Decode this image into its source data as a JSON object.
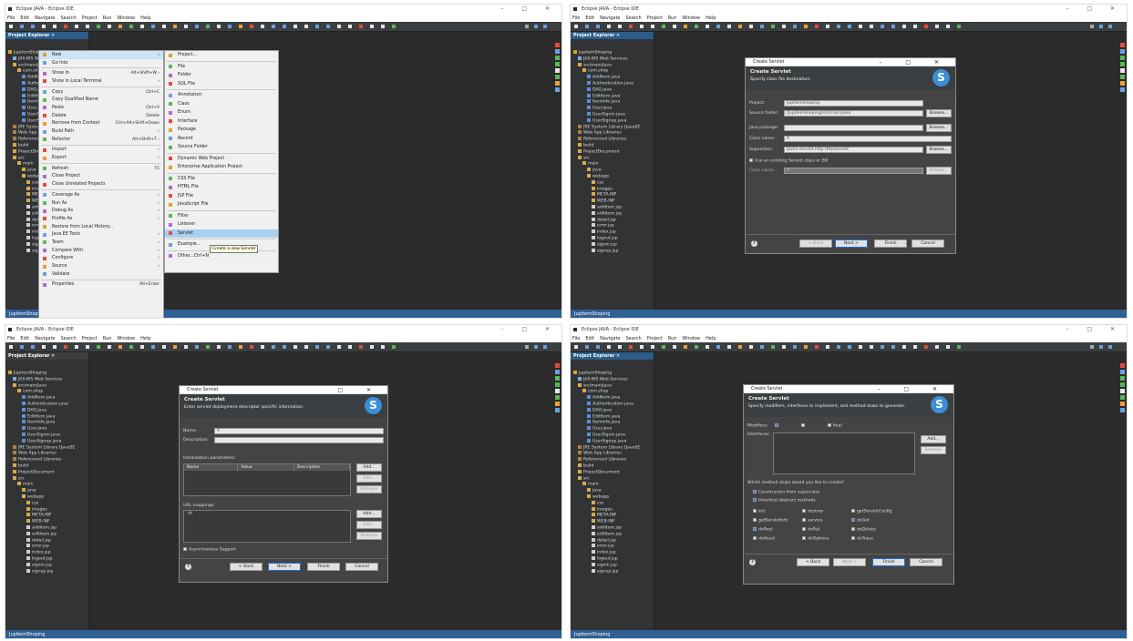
{
  "window": {
    "title": "Eclipse JAVA - Eclipse IDE",
    "menu": [
      "File",
      "Edit",
      "Navigate",
      "Search",
      "Project",
      "Run",
      "Window",
      "Help"
    ],
    "controls": [
      "–",
      "□",
      "✕"
    ]
  },
  "project_explorer": {
    "tab_label": "Project Explorer",
    "tree": [
      {
        "label": "JupitemShoping",
        "indent": 0,
        "icon": "project"
      },
      {
        "label": "JAX-WS Web Services",
        "indent": 1,
        "icon": "ws"
      },
      {
        "label": "src/main/java",
        "indent": 1,
        "icon": "srcfolder"
      },
      {
        "label": "com.shop",
        "indent": 2,
        "icon": "package"
      },
      {
        "label": "AddItem.java",
        "indent": 3,
        "icon": "java"
      },
      {
        "label": "Authentication.java",
        "indent": 3,
        "icon": "java"
      },
      {
        "label": "DAO.java",
        "indent": 3,
        "icon": "java"
      },
      {
        "label": "EditItem.java",
        "indent": 3,
        "icon": "java"
      },
      {
        "label": "ItemInfo.java",
        "indent": 3,
        "icon": "java"
      },
      {
        "label": "User.java",
        "indent": 3,
        "icon": "java"
      },
      {
        "label": "UserSignin.java",
        "indent": 3,
        "icon": "java"
      },
      {
        "label": "UserSignup.java",
        "indent": 3,
        "icon": "java"
      },
      {
        "label": "JRE System Library [JavaSE",
        "indent": 1,
        "icon": "lib"
      },
      {
        "label": "Web App Libraries",
        "indent": 1,
        "icon": "lib"
      },
      {
        "label": "Referenced Libraries",
        "indent": 1,
        "icon": "lib"
      },
      {
        "label": "build",
        "indent": 1,
        "icon": "folder"
      },
      {
        "label": "ProjectDocument",
        "indent": 1,
        "icon": "folder"
      },
      {
        "label": "src",
        "indent": 1,
        "icon": "folder"
      },
      {
        "label": "main",
        "indent": 2,
        "icon": "folder"
      },
      {
        "label": "java",
        "indent": 3,
        "icon": "folder"
      },
      {
        "label": "webapp",
        "indent": 3,
        "icon": "folder"
      },
      {
        "label": "css",
        "indent": 4,
        "icon": "folder"
      },
      {
        "label": "images",
        "indent": 4,
        "icon": "folder"
      },
      {
        "label": "META-INF",
        "indent": 4,
        "icon": "folder"
      },
      {
        "label": "WEB-INF",
        "indent": 4,
        "icon": "folder"
      },
      {
        "label": "additem.jsp",
        "indent": 4,
        "icon": "file"
      },
      {
        "label": "edititem.jsp",
        "indent": 4,
        "icon": "file"
      },
      {
        "label": "detail.jsp",
        "indent": 4,
        "icon": "file"
      },
      {
        "label": "error.jsp",
        "indent": 4,
        "icon": "file"
      },
      {
        "label": "index.jsp",
        "indent": 4,
        "icon": "file"
      },
      {
        "label": "logout.jsp",
        "indent": 4,
        "icon": "file"
      },
      {
        "label": "signin.jsp",
        "indent": 4,
        "icon": "file"
      },
      {
        "label": "signup.jsp",
        "indent": 4,
        "icon": "file"
      }
    ]
  },
  "status_text": "JupitemShoping",
  "context_menu": {
    "items": [
      {
        "label": "New",
        "shortcut": "›",
        "hl": true
      },
      {
        "label": "Go Into",
        "shortcut": ""
      },
      {
        "sep": true
      },
      {
        "label": "Show In",
        "shortcut": "Alt+Shift+W ›"
      },
      {
        "label": "Show in Local Terminal",
        "shortcut": "›"
      },
      {
        "sep": true
      },
      {
        "label": "Copy",
        "shortcut": "Ctrl+C"
      },
      {
        "label": "Copy Qualified Name",
        "shortcut": ""
      },
      {
        "label": "Paste",
        "shortcut": "Ctrl+V"
      },
      {
        "label": "Delete",
        "shortcut": "Delete"
      },
      {
        "label": "Remove from Context",
        "shortcut": "Ctrl+Alt+Shift+Down"
      },
      {
        "label": "Build Path",
        "shortcut": "›"
      },
      {
        "label": "Refactor",
        "shortcut": "Alt+Shift+T ›"
      },
      {
        "sep": true
      },
      {
        "label": "Import",
        "shortcut": "›"
      },
      {
        "label": "Export",
        "shortcut": "›"
      },
      {
        "sep": true
      },
      {
        "label": "Refresh",
        "shortcut": "F5"
      },
      {
        "label": "Close Project",
        "shortcut": ""
      },
      {
        "label": "Close Unrelated Projects",
        "shortcut": ""
      },
      {
        "sep": true
      },
      {
        "label": "Coverage As",
        "shortcut": "›"
      },
      {
        "label": "Run As",
        "shortcut": "›"
      },
      {
        "label": "Debug As",
        "shortcut": "›"
      },
      {
        "label": "Profile As",
        "shortcut": "›"
      },
      {
        "label": "Restore from Local History...",
        "shortcut": ""
      },
      {
        "label": "Java EE Tools",
        "shortcut": "›"
      },
      {
        "label": "Team",
        "shortcut": "›"
      },
      {
        "label": "Compare With",
        "shortcut": "›"
      },
      {
        "label": "Configure",
        "shortcut": "›"
      },
      {
        "label": "Source",
        "shortcut": "›"
      },
      {
        "label": "Validate",
        "shortcut": ""
      },
      {
        "sep": true
      },
      {
        "label": "Properties",
        "shortcut": "Alt+Enter"
      }
    ]
  },
  "new_submenu": {
    "items": [
      {
        "label": "Project..."
      },
      {
        "sep": true
      },
      {
        "label": "File"
      },
      {
        "label": "Folder"
      },
      {
        "label": "SQL File"
      },
      {
        "sep": true
      },
      {
        "label": "Annotation"
      },
      {
        "label": "Class"
      },
      {
        "label": "Enum"
      },
      {
        "label": "Interface"
      },
      {
        "label": "Package"
      },
      {
        "label": "Record"
      },
      {
        "label": "Source Folder"
      },
      {
        "sep": true
      },
      {
        "label": "Dynamic Web Project"
      },
      {
        "label": "Enterprise Application Project"
      },
      {
        "sep": true
      },
      {
        "label": "CSS File"
      },
      {
        "label": "HTML File"
      },
      {
        "label": "JSP File"
      },
      {
        "label": "JavaScript File"
      },
      {
        "sep": true
      },
      {
        "label": "Filter"
      },
      {
        "label": "Listener"
      },
      {
        "label": "Servlet",
        "hl": true
      },
      {
        "sep": true
      },
      {
        "label": "Example..."
      },
      {
        "sep": true
      },
      {
        "label": "Other...",
        "shortcut": "Ctrl+N"
      }
    ],
    "tooltip": "Create a new Servlet"
  },
  "dialog1": {
    "title": "Create Servlet",
    "heading": "Create Servlet",
    "desc": "Specify class file destination.",
    "project_label": "Project:",
    "project_value": "JupitemShoping",
    "source_label": "Source folder:",
    "source_value": "/JupitemShoping/src/main/java",
    "package_label": "Java package:",
    "package_value": "",
    "class_label": "Class name:",
    "class_value": "A",
    "super_label": "Superclass:",
    "super_value": "javax.servlet.http.HttpServlet",
    "existing_label": "Use an existing Servlet class or JSP",
    "classname2_label": "Class name:",
    "classname2_value": "A",
    "browse": "Browse...",
    "browse2": "Browse...",
    "browse3": "Browse..."
  },
  "dialog2": {
    "title": "Create Servlet",
    "heading": "Create Servlet",
    "desc": "Enter servlet deployment descriptor specific information.",
    "name_label": "Name:",
    "name_value": "A",
    "desc_label": "Description:",
    "init_label": "Initialization parameters:",
    "cols": [
      "Name",
      "Value",
      "Description"
    ],
    "url_label": "URL mappings:",
    "url_value": "/A",
    "async_label": "Asynchronous Support",
    "add": "Add...",
    "edit": "Edit...",
    "remove": "Remove",
    "add2": "Add...",
    "edit2": "Edit...",
    "remove2": "Remove"
  },
  "dialog3": {
    "title": "Create Servlet",
    "heading": "Create Servlet",
    "desc": "Specify modifiers, interfaces to implement, and method stubs to generate.",
    "modifiers_label": "Modifiers:",
    "mod_final": "final",
    "interfaces_label": "Interfaces:",
    "add": "Add...",
    "remove": "Remove",
    "stubs_q": "Which method stubs would you like to create?",
    "constructors": "Constructors from superclass",
    "inherited": "Inherited abstract methods",
    "methods": [
      {
        "label": "init",
        "on": false
      },
      {
        "label": "destroy",
        "on": false
      },
      {
        "label": "getServletConfig",
        "on": false
      },
      {
        "label": "getServletInfo",
        "on": false
      },
      {
        "label": "service",
        "on": false
      },
      {
        "label": "doGet",
        "on": true
      },
      {
        "label": "doPost",
        "on": true
      },
      {
        "label": "doPut",
        "on": false
      },
      {
        "label": "doDelete",
        "on": false
      },
      {
        "label": "doHead",
        "on": false
      },
      {
        "label": "doOptions",
        "on": false
      },
      {
        "label": "doTrace",
        "on": false
      }
    ]
  },
  "buttons": {
    "back": "< Back",
    "next": "Next >",
    "finish": "Finish",
    "cancel": "Cancel"
  },
  "help_glyph": "?",
  "logo_glyph": "S"
}
